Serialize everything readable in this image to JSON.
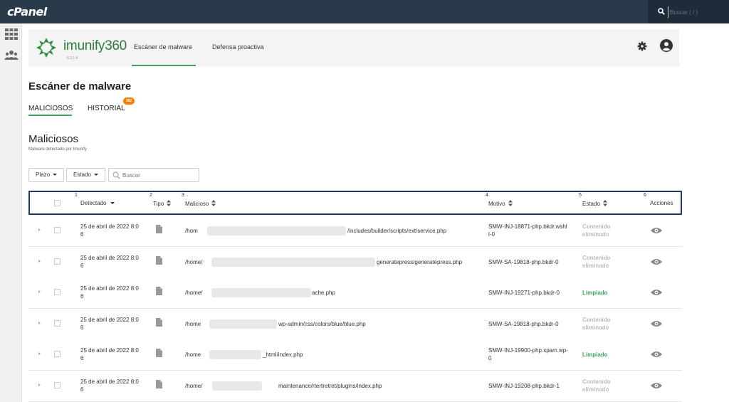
{
  "topbar": {
    "brand": "cPanel",
    "search_placeholder": "Buscar ( / )"
  },
  "imunify": {
    "name": "imunify360",
    "version": "6.3.1-4",
    "tabs": [
      {
        "label": "Escáner de malware",
        "active": true
      },
      {
        "label": "Defensa proactiva",
        "active": false
      }
    ]
  },
  "page": {
    "title": "Escáner de malware",
    "subtabs": [
      {
        "label": "MALICIOSOS",
        "active": true
      },
      {
        "label": "HISTORIAL",
        "active": false,
        "badge": "302"
      }
    ],
    "section_title": "Maliciosos",
    "section_subtitle": "Malware detectado por Imunify"
  },
  "filters": {
    "plazo_label": "Plazo",
    "estado_label": "Estado",
    "search_placeholder": "Buscar"
  },
  "table": {
    "columns": [
      {
        "num": "1",
        "label": "Detectado"
      },
      {
        "num": "2",
        "label": "Tipo"
      },
      {
        "num": "3",
        "label": "Malicioso"
      },
      {
        "num": "4",
        "label": "Motivo"
      },
      {
        "num": "5",
        "label": "Estado"
      },
      {
        "num": "6",
        "label": "Acciones"
      }
    ],
    "rows": [
      {
        "date1": "25 de abril de 2022 8:0",
        "date2": "6",
        "path_start": "/hom",
        "path_end": "/includes/builder/scripts/ext/service.php",
        "reason1": "SMW-INJ-18871-php.bkdr.wshl",
        "reason2": "l-0",
        "status1": "Contenido",
        "status2": "eliminado",
        "status_type": "removed"
      },
      {
        "date1": "25 de abril de 2022 8:0",
        "date2": "6",
        "path_start": "/home/",
        "path_end": "generatepress/generatepress.php",
        "reason1": "SMW-SA-19818-php.bkdr-0",
        "reason2": "",
        "status1": "Contenido",
        "status2": "eliminado",
        "status_type": "removed"
      },
      {
        "date1": "25 de abril de 2022 8:0",
        "date2": "6",
        "path_start": "/home/",
        "path_end": "ache.php",
        "reason1": "SMW-INJ-19271-php.bkdr-0",
        "reason2": "",
        "status1": "Limpiado",
        "status2": "",
        "status_type": "clean"
      },
      {
        "date1": "25 de abril de 2022 8:0",
        "date2": "6",
        "path_start": "/home",
        "path_end": "wp-admin/css/colors/blue/blue.php",
        "reason1": "SMW-SA-19818-php.bkdr-0",
        "reason2": "",
        "status1": "Contenido",
        "status2": "eliminado",
        "status_type": "removed"
      },
      {
        "date1": "25 de abril de 2022 8:0",
        "date2": "6",
        "path_start": "/home",
        "path_end": "_html/index.php",
        "reason1": "SMW-INJ-19900-php.spam.wp-",
        "reason2": "0",
        "status1": "Limpiado",
        "status2": "",
        "status_type": "clean"
      },
      {
        "date1": "25 de abril de 2022 8:0",
        "date2": "6",
        "path_start": "/home/",
        "path_end": "maintenance/rtertretret/plugins/index.php",
        "reason1": "SMW-INJ-19208-php.bkdr-1",
        "reason2": "",
        "status1": "Contenido",
        "status2": "eliminado",
        "status_type": "removed"
      }
    ]
  },
  "colors": {
    "accent": "#3ba55d",
    "topbar": "#293a4a",
    "badge": "#f57c00",
    "header_border": "#1f3a63"
  }
}
